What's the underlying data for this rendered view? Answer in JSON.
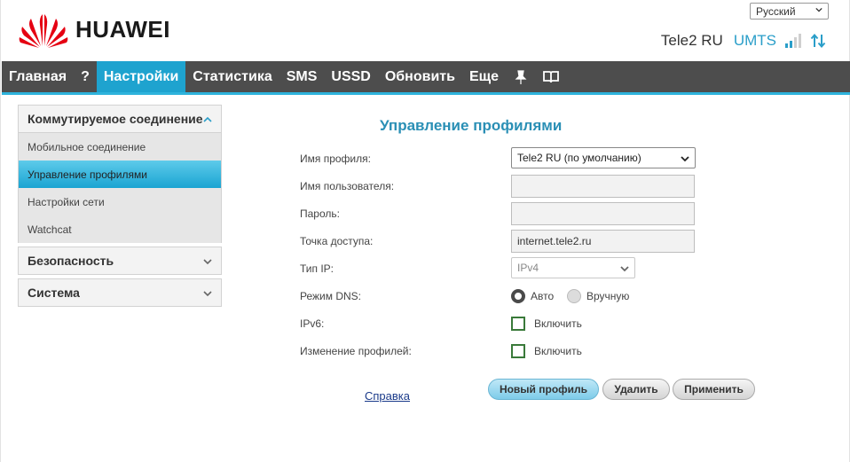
{
  "brand": {
    "name": "HUAWEI",
    "icon": "huawei-logo-icon",
    "color": "#e50012"
  },
  "language": {
    "selected": "Русский"
  },
  "status": {
    "operator": "Tele2 RU",
    "network_type": "UMTS",
    "signal_bars": 2,
    "signal_total": 4,
    "signal_icon": "signal-bars-icon",
    "transfer_icon": "up-down-arrows-icon"
  },
  "nav": {
    "items": [
      "Главная",
      "?",
      "Настройки",
      "Статистика",
      "SMS",
      "USSD",
      "Обновить",
      "Еще"
    ],
    "active": "Настройки",
    "icons": [
      "pin-icon",
      "book-icon"
    ],
    "accent": "#1ea3cf"
  },
  "sidebar": {
    "sections": [
      {
        "title": "Коммутируемое соединение",
        "expanded": true,
        "items": [
          "Мобильное соединение",
          "Управление профилями",
          "Настройки сети",
          "Watchcat"
        ],
        "active": "Управление профилями"
      },
      {
        "title": "Безопасность",
        "expanded": false
      },
      {
        "title": "Система",
        "expanded": false
      }
    ]
  },
  "form": {
    "title": "Управление профилями",
    "profile_name": {
      "label": "Имя профиля:",
      "value": "Tele2 RU (по умолчанию)"
    },
    "username": {
      "label": "Имя пользователя:",
      "value": ""
    },
    "password": {
      "label": "Пароль:",
      "value": ""
    },
    "apn": {
      "label": "Точка доступа:",
      "value": "internet.tele2.ru"
    },
    "ip_type": {
      "label": "Тип IP:",
      "value": "IPv4"
    },
    "dns_mode": {
      "label": "Режим DNS:",
      "options": [
        "Авто",
        "Вручную"
      ],
      "selected": "Авто"
    },
    "ipv6": {
      "label": "IPv6:",
      "option": "Включить",
      "checked": false
    },
    "profile_change": {
      "label": "Изменение профилей:",
      "option": "Включить",
      "checked": false
    }
  },
  "actions": {
    "help": "Справка",
    "new_profile": "Новый профиль",
    "delete": "Удалить",
    "apply": "Применить"
  }
}
